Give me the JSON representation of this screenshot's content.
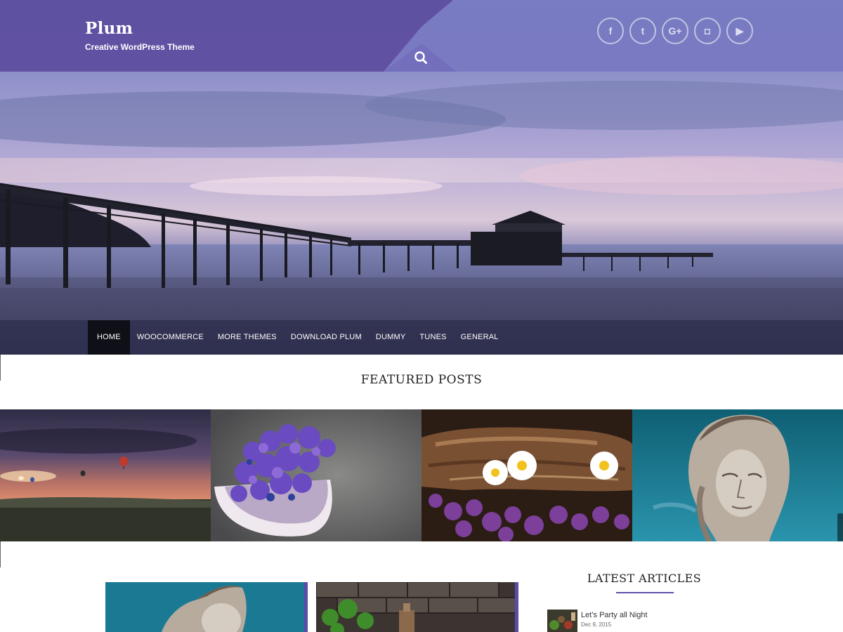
{
  "site": {
    "title": "Plum",
    "tagline": "Creative WordPress Theme"
  },
  "header": {
    "search_icon": "search-icon",
    "social": [
      {
        "name": "facebook-icon",
        "glyph": "f"
      },
      {
        "name": "twitter-icon",
        "glyph": "t"
      },
      {
        "name": "google-plus-icon",
        "glyph": "G+"
      },
      {
        "name": "instagram-icon",
        "glyph": "◘"
      },
      {
        "name": "youtube-icon",
        "glyph": "▶"
      }
    ]
  },
  "nav": {
    "items": [
      {
        "label": "HOME",
        "active": true
      },
      {
        "label": "WOOCOMMERCE",
        "active": false
      },
      {
        "label": "MORE THEMES",
        "active": false
      },
      {
        "label": "DOWNLOAD PLUM",
        "active": false
      },
      {
        "label": "DUMMY",
        "active": false
      },
      {
        "label": "TUNES",
        "active": false
      },
      {
        "label": "GENERAL",
        "active": false
      }
    ]
  },
  "featured": {
    "heading": "FEATURED POSTS"
  },
  "latest": {
    "heading": "LATEST ARTICLES",
    "articles": [
      {
        "title": "Let’s Party all Night",
        "date": "Dec 9, 2015"
      }
    ]
  },
  "colors": {
    "accent": "#5e4ea8",
    "header": "#5d4d9f",
    "nav_bg": "#2a2a44",
    "nav_active": "#0f0f17"
  }
}
